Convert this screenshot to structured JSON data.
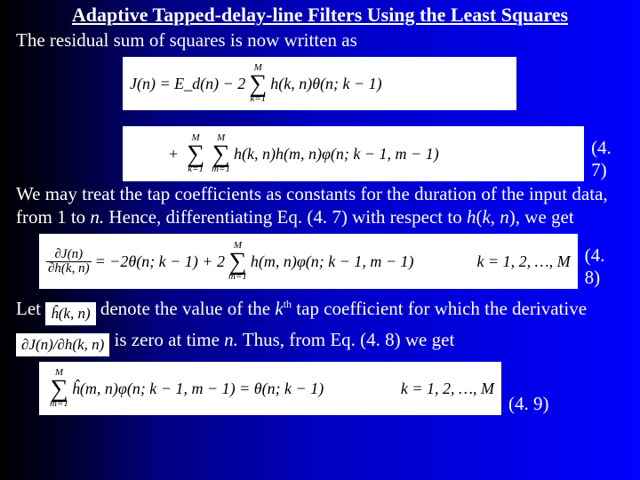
{
  "title": "Adaptive Tapped-delay-line Filters Using the Least Squares",
  "intro": "The residual sum of squares is now written as",
  "eq47_top": {
    "lhs": "J(n) = E_d(n) − 2",
    "sum_upper": "M",
    "sum_lower": "k=1",
    "rhs": "h(k, n)θ(n; k − 1)"
  },
  "eq47_bottom": {
    "plus": "+",
    "sum1_upper": "M",
    "sum1_lower": "k=1",
    "sum2_upper": "M",
    "sum2_lower": "m=1",
    "body": "h(k, n)h(m, n)φ(n; k − 1, m − 1)"
  },
  "ref47": "(4. 7)",
  "para47": {
    "p1": "We may treat the tap coefficients as constants for the duration of the input data, from 1 to ",
    "p2": "n.",
    "p3": " Hence, differentiating Eq. (4. 7) with respect to ",
    "p4": "h",
    "p5": "(",
    "p6": "k",
    "p7": ", ",
    "p8": "n",
    "p9": "), we get"
  },
  "eq48": {
    "frac_num": "∂J(n)",
    "frac_den": "∂h(k, n)",
    "eq": "= −2θ(n; k − 1) + 2",
    "sum_upper": "M",
    "sum_lower": "m=1",
    "body": "h(m, n)φ(n; k − 1, m − 1)",
    "cond": "k = 1, 2, …, M"
  },
  "ref48": "(4. 8)",
  "let": {
    "p1": "Let ",
    "hhat": "ĥ(k, n)",
    "p2": "  denote the value of the ",
    "p3": "k",
    "p4": "th",
    "p5": " tap coefficient for which the derivative ",
    "partial": "∂J(n)/∂h(k, n)",
    "p6": "  is zero at time ",
    "p7": "n.",
    "p8": " Thus, from Eq. (4. 8) we get"
  },
  "eq49": {
    "sum_upper": "M",
    "sum_lower": "m=1",
    "body": "ĥ(m, n)φ(n; k − 1, m − 1) = θ(n; k − 1)",
    "cond": "k = 1, 2, …, M"
  },
  "ref49": "(4. 9)"
}
